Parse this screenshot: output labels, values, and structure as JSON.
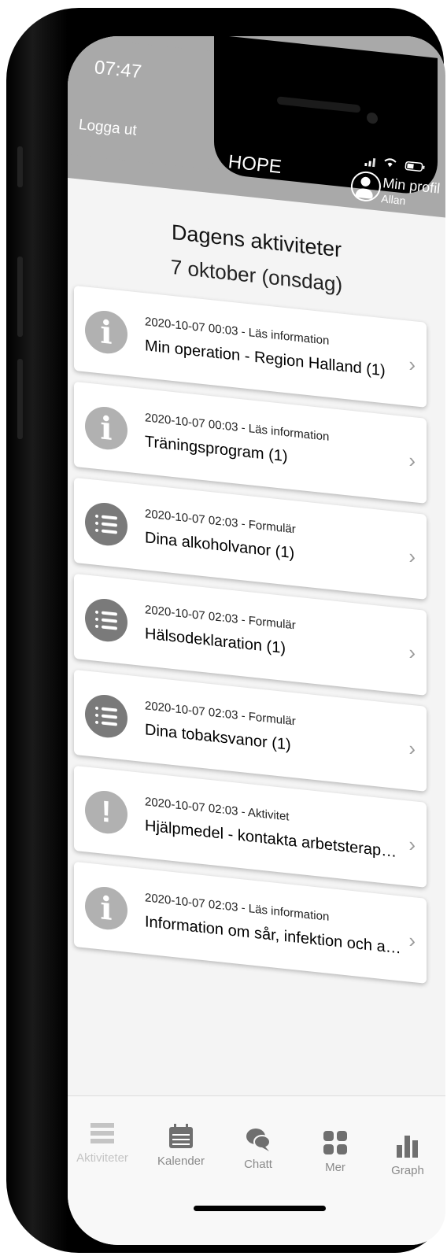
{
  "status_bar": {
    "time": "07:47"
  },
  "header": {
    "logout_label": "Logga ut",
    "app_title": "HOPE",
    "profile_label": "Min profil",
    "profile_user": "Allan"
  },
  "page": {
    "title": "Dagens aktiviteter",
    "date": "7 oktober (onsdag)"
  },
  "activities": [
    {
      "meta": "2020-10-07 00:03 - Läs information",
      "title": "Min operation - Region Halland (1)",
      "icon": "info-icon"
    },
    {
      "meta": "2020-10-07 00:03 - Läs information",
      "title": "Träningsprogram (1)",
      "icon": "info-icon"
    },
    {
      "meta": "2020-10-07 02:03 - Formulär",
      "title": "Dina alkoholvanor (1)",
      "icon": "form-list-icon"
    },
    {
      "meta": "2020-10-07 02:03 - Formulär",
      "title": "Hälsodeklaration (1)",
      "icon": "form-list-icon"
    },
    {
      "meta": "2020-10-07 02:03 - Formulär",
      "title": "Dina tobaksvanor (1)",
      "icon": "form-list-icon"
    },
    {
      "meta": "2020-10-07 02:03 - Aktivitet",
      "title": "Hjälpmedel - kontakta arbetsterapeut ...",
      "icon": "exclamation-icon"
    },
    {
      "meta": "2020-10-07 02:03 - Läs information",
      "title": "Information om sår, infektion och aller...",
      "icon": "info-icon"
    }
  ],
  "tabs": [
    {
      "label": "Aktiviteter",
      "icon": "activities-icon",
      "active": true
    },
    {
      "label": "Kalender",
      "icon": "calendar-icon",
      "active": false
    },
    {
      "label": "Chatt",
      "icon": "chat-icon",
      "active": false
    },
    {
      "label": "Mer",
      "icon": "grid-icon",
      "active": false
    },
    {
      "label": "Graph",
      "icon": "bar-chart-icon",
      "active": false
    }
  ],
  "colors": {
    "header": "#a9a9a9",
    "icon_info": "#b1b1b1",
    "icon_form": "#7a7a7a",
    "tab_inactive": "#8a8a8a",
    "tab_active": "#c4c4c4"
  }
}
